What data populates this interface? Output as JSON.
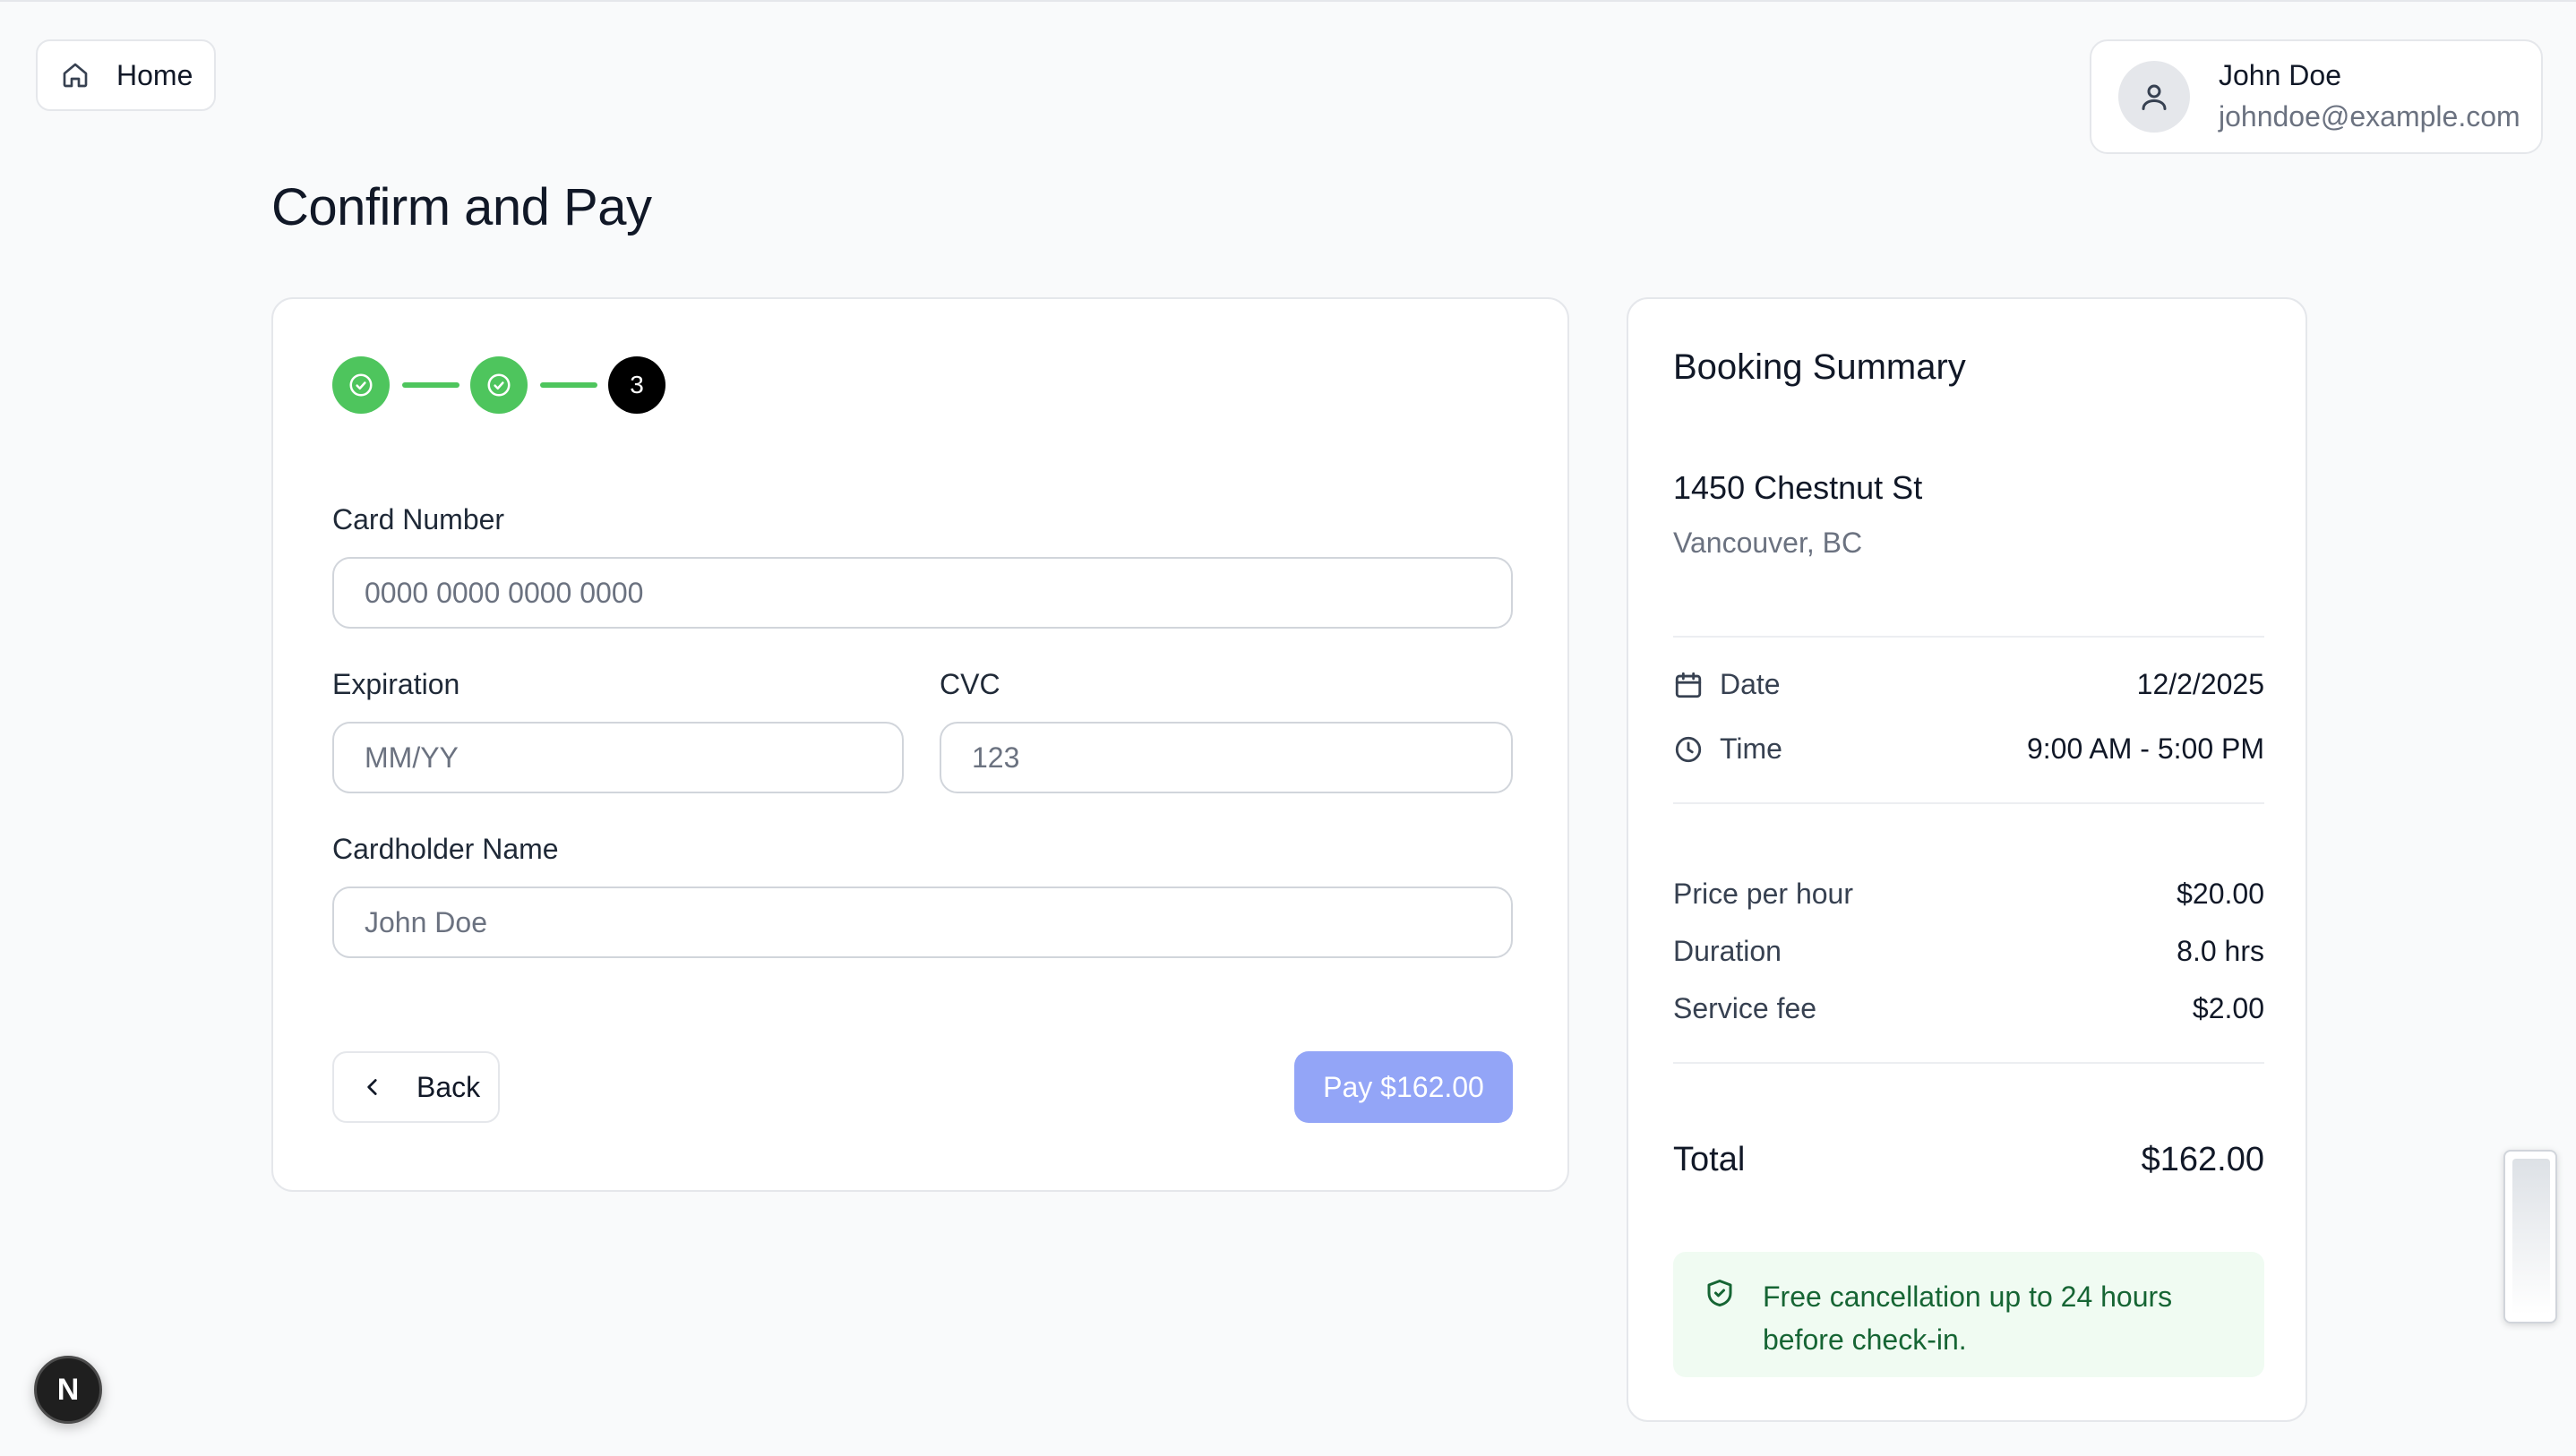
{
  "nav": {
    "home_label": "Home"
  },
  "user": {
    "name": "John Doe",
    "email": "johndoe@example.com"
  },
  "page": {
    "title": "Confirm and Pay"
  },
  "stepper": {
    "active_step": "3"
  },
  "form": {
    "card_number": {
      "label": "Card Number",
      "placeholder": "0000 0000 0000 0000",
      "value": ""
    },
    "expiration": {
      "label": "Expiration",
      "placeholder": "MM/YY",
      "value": ""
    },
    "cvc": {
      "label": "CVC",
      "placeholder": "123",
      "value": ""
    },
    "cardholder": {
      "label": "Cardholder Name",
      "placeholder": "John Doe",
      "value": ""
    },
    "back_label": "Back",
    "pay_label": "Pay $162.00"
  },
  "summary": {
    "title": "Booking Summary",
    "address": "1450 Chestnut St",
    "city": "Vancouver, BC",
    "date_label": "Date",
    "date_value": "12/2/2025",
    "time_label": "Time",
    "time_value": "9:00 AM - 5:00 PM",
    "price_label": "Price per hour",
    "price_value": "$20.00",
    "duration_label": "Duration",
    "duration_value": "8.0 hrs",
    "fee_label": "Service fee",
    "fee_value": "$2.00",
    "total_label": "Total",
    "total_value": "$162.00",
    "note": "Free cancellation up to 24 hours before check-in."
  },
  "badge": {
    "label": "N"
  },
  "colors": {
    "success": "#4ec55d",
    "pay_button": "#93a5f7",
    "note_bg": "#f0fbf2",
    "note_text": "#166534"
  }
}
